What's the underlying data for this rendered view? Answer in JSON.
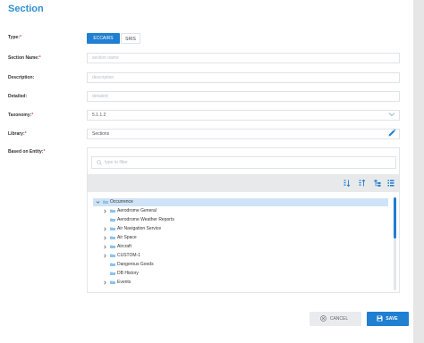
{
  "page": {
    "title": "Section"
  },
  "form": {
    "type": {
      "label": "Type:",
      "options": [
        "ECCAIRS",
        "SRIS"
      ],
      "selected": "ECCAIRS"
    },
    "section_name": {
      "label": "Section Name:",
      "placeholder": "section name",
      "value": ""
    },
    "description": {
      "label": "Description:",
      "placeholder": "description",
      "value": ""
    },
    "detailed": {
      "label": "Detailed:",
      "placeholder": "detailed",
      "value": ""
    },
    "taxonomy": {
      "label": "Taxonomy:",
      "value": "5.1.1.2"
    },
    "library": {
      "label": "Library:",
      "value": "Sections"
    },
    "based_on_entity": {
      "label": "Based on Entity:"
    },
    "required_mark": "*"
  },
  "entity_panel": {
    "filter_placeholder": "type to filter",
    "tree": [
      {
        "label": "Occurrence",
        "level": 0,
        "expanded": true,
        "selected": true,
        "has_children": true
      },
      {
        "label": "Aerodrome General",
        "level": 1,
        "has_children": true
      },
      {
        "label": "Aerodrome Weather Reports",
        "level": 1,
        "has_children": false
      },
      {
        "label": "Air Navigation Service",
        "level": 1,
        "has_children": true
      },
      {
        "label": "Air Space",
        "level": 1,
        "has_children": true
      },
      {
        "label": "Aircraft",
        "level": 1,
        "has_children": true
      },
      {
        "label": "CUSTOM-1",
        "level": 1,
        "has_children": true
      },
      {
        "label": "Dangerous Goods",
        "level": 1,
        "has_children": false
      },
      {
        "label": "DB History",
        "level": 1,
        "has_children": false
      },
      {
        "label": "Events",
        "level": 1,
        "has_children": true
      }
    ]
  },
  "buttons": {
    "cancel": "CANCEL",
    "save": "SAVE"
  },
  "colors": {
    "accent": "#1f7fd1",
    "title": "#2f8fd6",
    "required": "#d9534f",
    "folder": "#8fc3ea"
  }
}
